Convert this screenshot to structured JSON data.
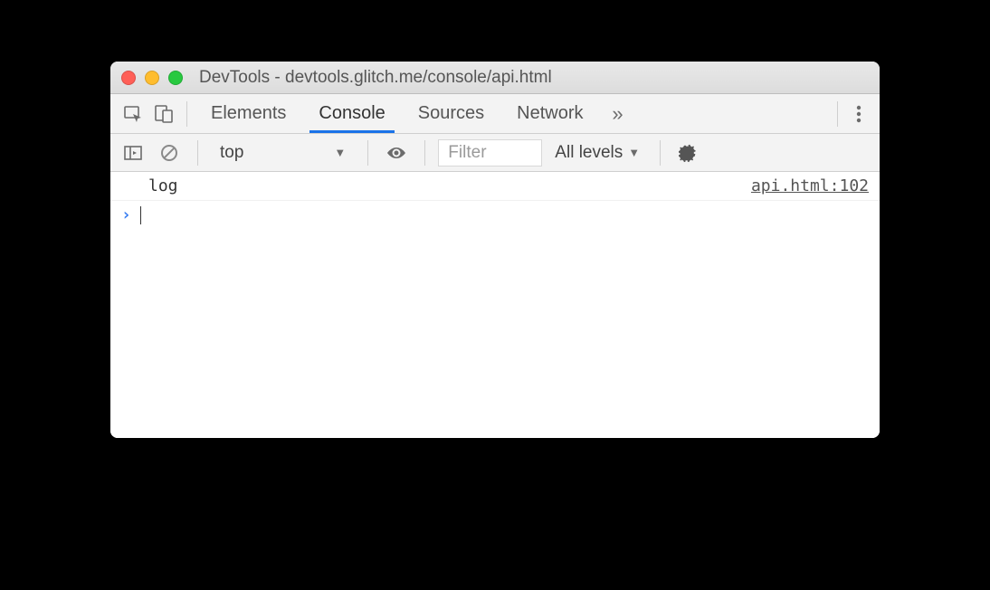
{
  "window": {
    "title": "DevTools - devtools.glitch.me/console/api.html"
  },
  "tabs": {
    "elements": "Elements",
    "console": "Console",
    "sources": "Sources",
    "network": "Network",
    "overflow": "»"
  },
  "toolbar": {
    "context": "top",
    "filter_placeholder": "Filter",
    "levels": "All levels"
  },
  "console": {
    "entries": [
      {
        "message": "log",
        "source": "api.html:102"
      }
    ],
    "prompt": "›"
  }
}
